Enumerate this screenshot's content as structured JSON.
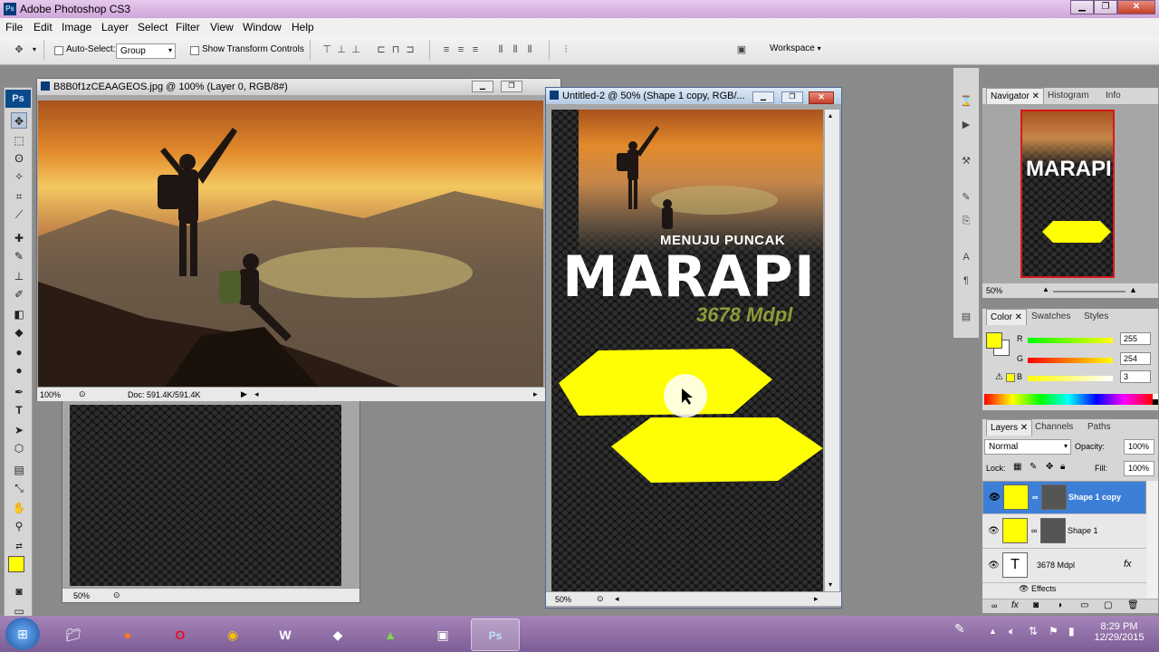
{
  "window": {
    "title": "Adobe Photoshop CS3",
    "app_icon": "Ps"
  },
  "menu": [
    "File",
    "Edit",
    "Image",
    "Layer",
    "Select",
    "Filter",
    "View",
    "Window",
    "Help"
  ],
  "options_bar": {
    "auto_select_label": "Auto-Select:",
    "auto_select_value": "Group",
    "show_transform_label": "Show Transform Controls",
    "workspace_label": "Workspace"
  },
  "tools_logo": "Ps",
  "doc1": {
    "title": "B8B0f1zCEAAGEOS.jpg @ 100% (Layer 0, RGB/8#)",
    "zoom": "100%",
    "doc_info": "Doc: 591.4K/591.4K"
  },
  "doc_hidden": {
    "zoom": "50%"
  },
  "doc2": {
    "title": "Untitled-2 @ 50% (Shape 1 copy, RGB/...",
    "zoom": "50%",
    "poster_line1": "MENUJU PUNCAK",
    "poster_line2": "MARAPI",
    "poster_line3": "3678 Mdpl"
  },
  "navigator": {
    "tabs": [
      "Navigator",
      "Histogram",
      "Info"
    ],
    "zoom": "50%"
  },
  "color_panel": {
    "tabs": [
      "Color",
      "Swatches",
      "Styles"
    ],
    "r_label": "R",
    "r_value": "255",
    "g_label": "G",
    "g_value": "254",
    "b_label": "B",
    "b_value": "3",
    "fg_color": "#fffe03"
  },
  "layers_panel": {
    "tabs": [
      "Layers",
      "Channels",
      "Paths"
    ],
    "blend_mode": "Normal",
    "opacity_label": "Opacity:",
    "opacity_value": "100%",
    "lock_label": "Lock:",
    "fill_label": "Fill:",
    "fill_value": "100%",
    "layers": [
      {
        "name": "Shape 1 copy",
        "selected": true
      },
      {
        "name": "Shape 1",
        "selected": false
      },
      {
        "name": "3678 Mdpl",
        "selected": false
      }
    ],
    "effects_label": "Effects"
  },
  "taskbar": {
    "time": "8:29 PM",
    "date": "12/29/2015"
  }
}
